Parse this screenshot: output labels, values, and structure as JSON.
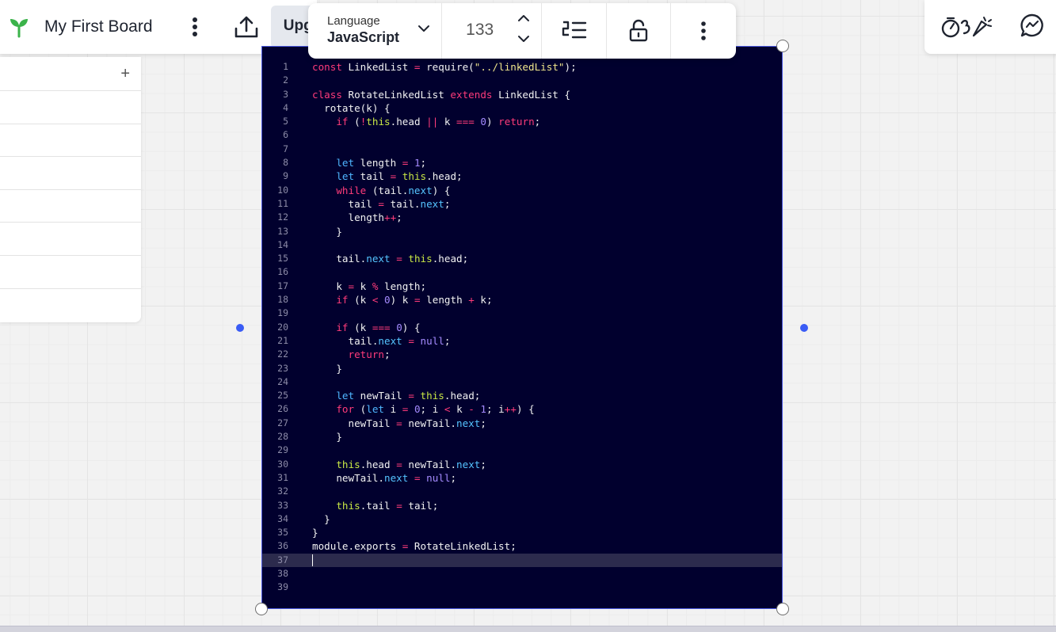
{
  "board": {
    "title": "My First Board",
    "upgrade_label": "Upgrade"
  },
  "code_toolbar": {
    "language_label": "Language",
    "language_value": "JavaScript",
    "font_size": "133"
  },
  "icons": {
    "logo": "sprout-logo-icon",
    "board_menu": "vertical-dots-icon",
    "share": "upload-icon",
    "language_dropdown": "chevron-down-icon",
    "size_up": "chevron-up-icon",
    "size_down": "chevron-down-icon",
    "line_numbers": "line-numbers-icon",
    "lock": "unlocked-padlock-icon",
    "more": "vertical-dots-icon",
    "reactions": "reactions-icon",
    "chat": "chat-bubble-icon",
    "add": "plus-icon"
  },
  "colors": {
    "code_background": "#01002e",
    "selection_border": "#4c5ae0",
    "keyword": "#ff3b7a",
    "this_keyword": "#c8e645",
    "string": "#f0e68c",
    "number": "#a58bff",
    "property": "#55c4ff",
    "side_handle": "#3a5cf5",
    "logo_green": "#3bb34a"
  },
  "left_panel": {
    "add_label": "+"
  },
  "code": {
    "active_line": 37,
    "lines": [
      "const LinkedList = require(\"../linkedList\");",
      "",
      "class RotateLinkedList extends LinkedList {",
      "  rotate(k) {",
      "    if (!this.head || k === 0) return;",
      "",
      "",
      "    let length = 1;",
      "    let tail = this.head;",
      "    while (tail.next) {",
      "      tail = tail.next;",
      "      length++;",
      "    }",
      "",
      "    tail.next = this.head;",
      "",
      "    k = k % length;",
      "    if (k < 0) k = length + k;",
      "",
      "    if (k === 0) {",
      "      tail.next = null;",
      "      return;",
      "    }",
      "",
      "    let newTail = this.head;",
      "    for (let i = 0; i < k - 1; i++) {",
      "      newTail = newTail.next;",
      "    }",
      "",
      "    this.head = newTail.next;",
      "    newTail.next = null;",
      "",
      "    this.tail = tail;",
      "  }",
      "}",
      "module.exports = RotateLinkedList;",
      "",
      "",
      ""
    ]
  }
}
